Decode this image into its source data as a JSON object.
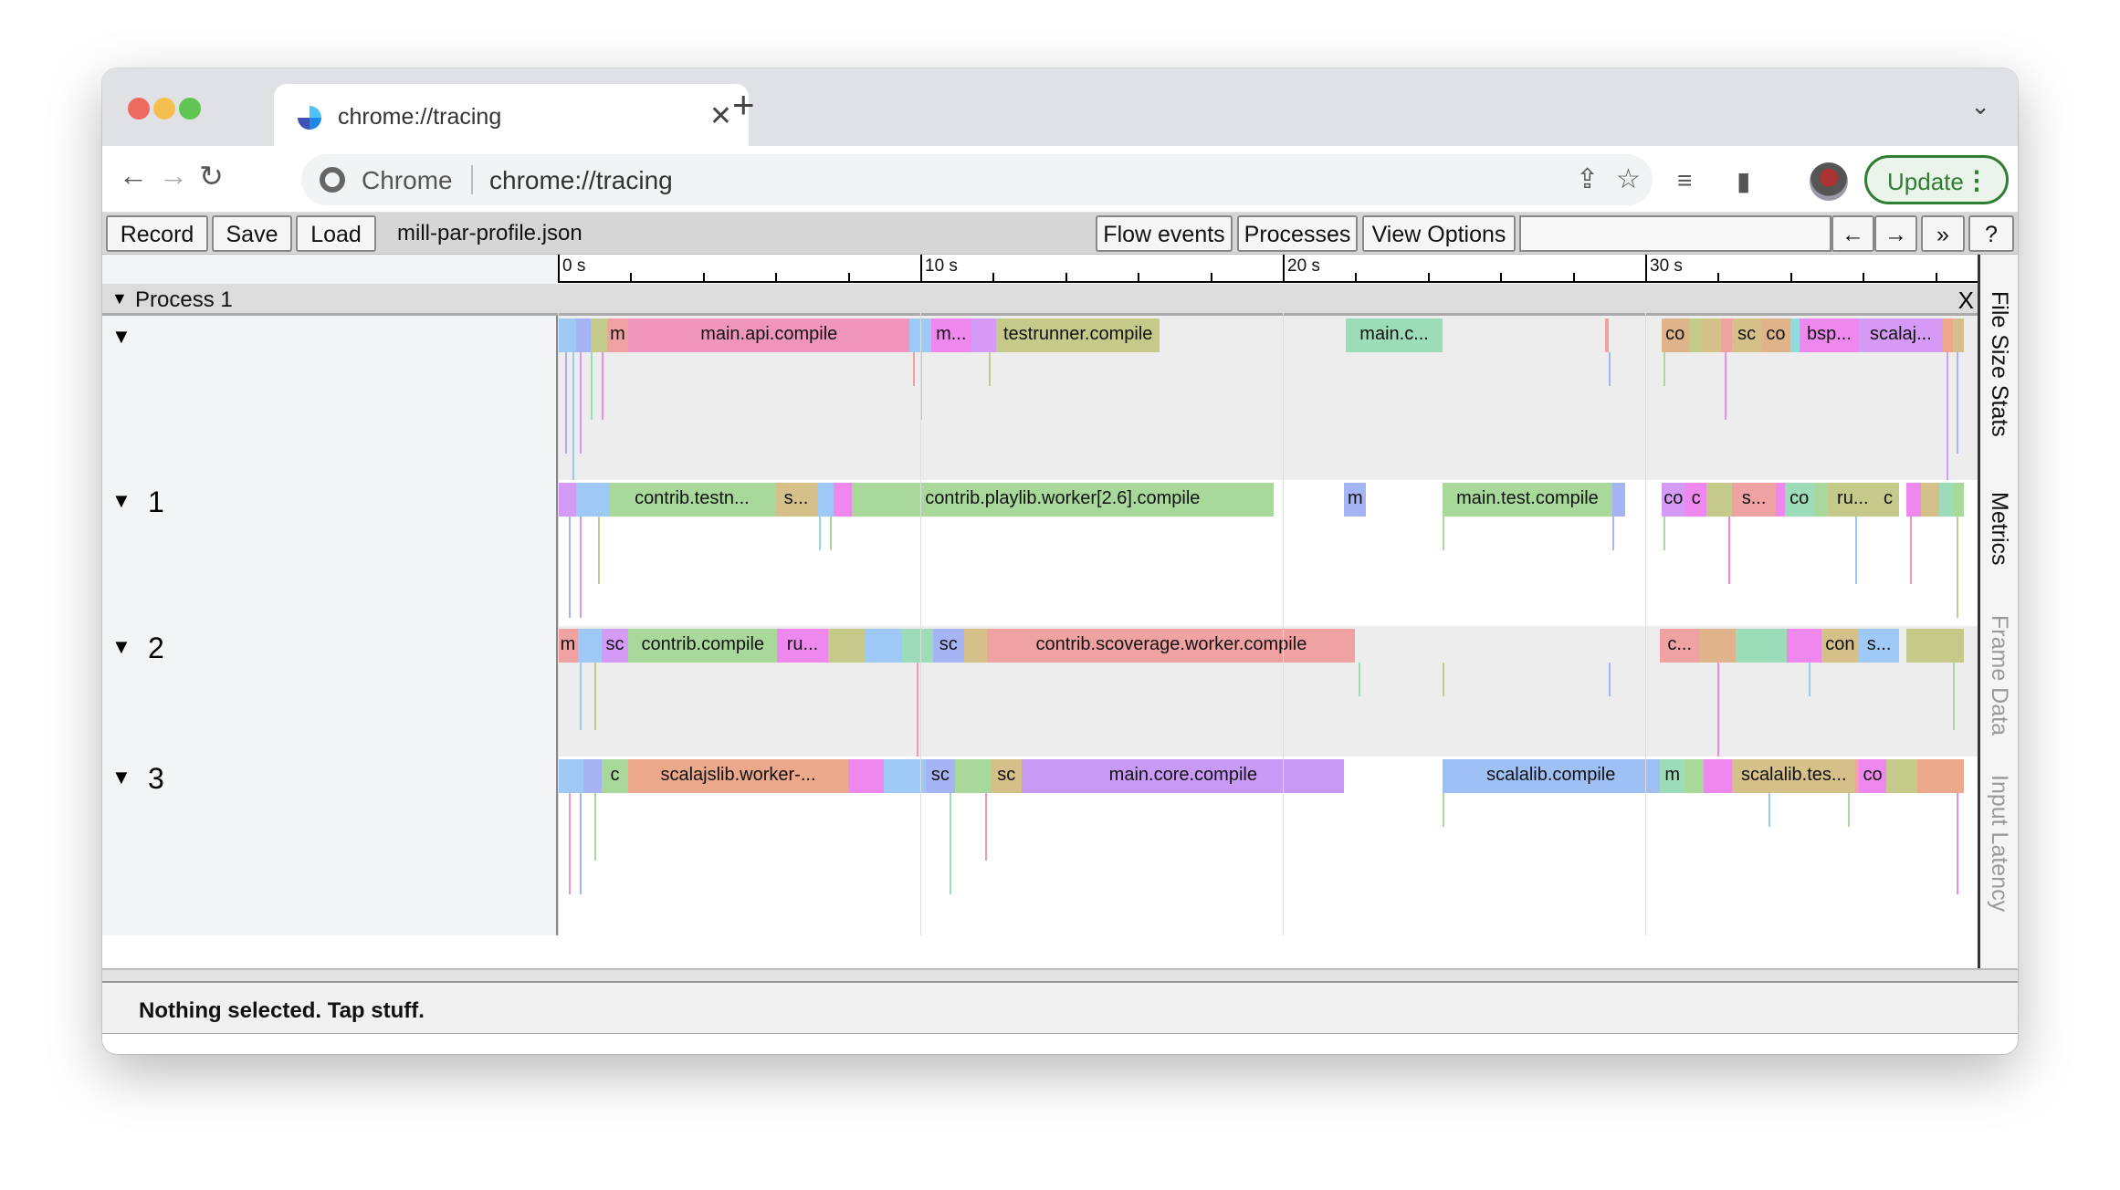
{
  "browser": {
    "tab_title": "chrome://tracing",
    "omnibox_label": "Chrome",
    "url": "chrome://tracing",
    "update_label": "Update",
    "traffic": {
      "close": "#ed6a5e",
      "min": "#f5bf4f",
      "max": "#61c554"
    }
  },
  "toolbar": {
    "record": "Record",
    "save": "Save",
    "load": "Load",
    "filename": "mill-par-profile.json",
    "flow_events": "Flow events",
    "processes": "Processes",
    "view_options": "View Options",
    "search_value": "",
    "prev": "←",
    "next": "→",
    "more": "»",
    "help": "?"
  },
  "ruler": {
    "labels": [
      {
        "t": 0,
        "text": "0 s"
      },
      {
        "t": 10,
        "text": "10 s"
      },
      {
        "t": 20,
        "text": "20 s"
      },
      {
        "t": 30,
        "text": "30 s"
      }
    ]
  },
  "process": {
    "label": "Process 1",
    "close": "X"
  },
  "side_tabs": [
    {
      "label": "File Size Stats",
      "enabled": true
    },
    {
      "label": "Metrics",
      "enabled": true
    },
    {
      "label": "Frame Data",
      "enabled": false
    },
    {
      "label": "Input Latency",
      "enabled": false
    }
  ],
  "status": "Nothing selected. Tap stuff.",
  "threads": [
    {
      "label": "",
      "slices": [
        {
          "s": 0,
          "e": 0.5,
          "c": "#9ec8f5"
        },
        {
          "s": 0.5,
          "e": 0.9,
          "c": "#a5b4f5"
        },
        {
          "s": 0.9,
          "e": 1.35,
          "c": "#c5c98a"
        },
        {
          "s": 1.35,
          "e": 1.95,
          "c": "#f0a1a1",
          "l": "m"
        },
        {
          "s": 1.95,
          "e": 9.7,
          "c": "#f096bd",
          "l": "main.api.compile"
        },
        {
          "s": 9.7,
          "e": 10.3,
          "c": "#9ec8f5"
        },
        {
          "s": 10.3,
          "e": 11.4,
          "c": "#ee88ee",
          "l": "m..."
        },
        {
          "s": 11.4,
          "e": 12.1,
          "c": "#d59af5"
        },
        {
          "s": 12.1,
          "e": 16.6,
          "c": "#c5c98a",
          "l": "testrunner.compile"
        },
        {
          "s": 21.75,
          "e": 24.4,
          "c": "#9cdcb8",
          "l": "main.c..."
        },
        {
          "s": 28.9,
          "e": 29.0,
          "c": "#f0a1a1"
        },
        {
          "s": 30.45,
          "e": 31.2,
          "c": "#dfb48a",
          "l": "co"
        },
        {
          "s": 31.2,
          "e": 31.6,
          "c": "#c5c98a"
        },
        {
          "s": 31.6,
          "e": 32.1,
          "c": "#d5c08a"
        },
        {
          "s": 32.1,
          "e": 32.4,
          "c": "#f0a1a1"
        },
        {
          "s": 32.4,
          "e": 33.2,
          "c": "#d5c08a",
          "l": "sc"
        },
        {
          "s": 33.2,
          "e": 34.0,
          "c": "#dfb48a",
          "l": "co"
        },
        {
          "s": 34.0,
          "e": 34.25,
          "c": "#8fdbe0"
        },
        {
          "s": 34.25,
          "e": 35.9,
          "c": "#ee88ee",
          "l": "bsp..."
        },
        {
          "s": 35.9,
          "e": 38.2,
          "c": "#d59af5",
          "l": "scalaj..."
        },
        {
          "s": 38.2,
          "e": 38.5,
          "c": "#eba88a"
        },
        {
          "s": 38.5,
          "e": 38.8,
          "c": "#d5c08a"
        }
      ],
      "deep": [
        [
          0.2,
          3,
          "#a5b4f5"
        ],
        [
          0.4,
          4,
          "#9ec8f5"
        ],
        [
          0.6,
          3,
          "#d59af5"
        ],
        [
          0.9,
          2,
          "#9cdcb8"
        ],
        [
          1.2,
          2,
          "#ee88ee"
        ],
        [
          9.8,
          1,
          "#f0a1a1"
        ],
        [
          10.0,
          2,
          "#9cdcb8"
        ],
        [
          11.9,
          1,
          "#c5c98a"
        ],
        [
          29.0,
          1,
          "#a5b4f5"
        ],
        [
          30.5,
          1,
          "#a9d99a"
        ],
        [
          32.2,
          2,
          "#ee88ee"
        ],
        [
          38.3,
          4,
          "#d59af5"
        ],
        [
          38.6,
          3,
          "#a5b4f5"
        ]
      ]
    },
    {
      "label": "1",
      "slices": [
        {
          "s": 0,
          "e": 0.5,
          "c": "#d59af5"
        },
        {
          "s": 0.5,
          "e": 1.4,
          "c": "#9ec8f5"
        },
        {
          "s": 1.4,
          "e": 6.0,
          "c": "#a9d99a",
          "l": "contrib.testn..."
        },
        {
          "s": 6.0,
          "e": 7.15,
          "c": "#d5c08a",
          "l": "s..."
        },
        {
          "s": 7.15,
          "e": 7.6,
          "c": "#9ec8f5"
        },
        {
          "s": 7.6,
          "e": 8.1,
          "c": "#ee88ee"
        },
        {
          "s": 8.1,
          "e": 19.75,
          "c": "#a9d99a",
          "l": "contrib.playlib.worker[2.6].compile"
        },
        {
          "s": 21.7,
          "e": 22.3,
          "c": "#a5b4f5",
          "l": "m"
        },
        {
          "s": 24.4,
          "e": 29.1,
          "c": "#a9d99a",
          "l": "main.test.compile"
        },
        {
          "s": 29.1,
          "e": 29.45,
          "c": "#a5b4f5"
        },
        {
          "s": 30.45,
          "e": 31.1,
          "c": "#d59af5",
          "l": "co"
        },
        {
          "s": 31.1,
          "e": 31.7,
          "c": "#ee88ee",
          "l": "c"
        },
        {
          "s": 31.7,
          "e": 32.4,
          "c": "#c5c98a"
        },
        {
          "s": 32.4,
          "e": 33.6,
          "c": "#f0a1a1",
          "l": "s..."
        },
        {
          "s": 33.6,
          "e": 33.85,
          "c": "#ee88ee"
        },
        {
          "s": 33.85,
          "e": 34.65,
          "c": "#9cdcb8",
          "l": "co"
        },
        {
          "s": 34.65,
          "e": 35.05,
          "c": "#a9d99a"
        },
        {
          "s": 35.05,
          "e": 36.4,
          "c": "#c5c98a",
          "l": "ru..."
        },
        {
          "s": 36.4,
          "e": 37.0,
          "c": "#c5c98a",
          "l": "c"
        },
        {
          "s": 37.2,
          "e": 37.6,
          "c": "#ee88ee"
        },
        {
          "s": 37.6,
          "e": 38.1,
          "c": "#d5c08a"
        },
        {
          "s": 38.1,
          "e": 38.5,
          "c": "#9cdcb8"
        },
        {
          "s": 38.5,
          "e": 38.8,
          "c": "#a9d99a"
        }
      ],
      "deep": [
        [
          0.3,
          3,
          "#a5b4f5"
        ],
        [
          0.6,
          3,
          "#d59af5"
        ],
        [
          1.1,
          2,
          "#c5c98a"
        ],
        [
          7.2,
          1,
          "#8fdbe0"
        ],
        [
          7.5,
          1,
          "#a9d99a"
        ],
        [
          24.4,
          1,
          "#a9d99a"
        ],
        [
          29.1,
          1,
          "#a5b4f5"
        ],
        [
          30.5,
          1,
          "#a9d99a"
        ],
        [
          32.3,
          2,
          "#ee88ee"
        ],
        [
          35.8,
          2,
          "#9ec8f5"
        ],
        [
          37.3,
          2,
          "#f096bd"
        ],
        [
          38.6,
          3,
          "#c5c98a"
        ]
      ]
    },
    {
      "label": "2",
      "slices": [
        {
          "s": 0,
          "e": 0.55,
          "c": "#f0a1a1",
          "l": "m"
        },
        {
          "s": 0.55,
          "e": 1.2,
          "c": "#9ec8f5"
        },
        {
          "s": 1.2,
          "e": 1.95,
          "c": "#d59af5",
          "l": "sc"
        },
        {
          "s": 1.95,
          "e": 6.05,
          "c": "#a9d99a",
          "l": "contrib.compile"
        },
        {
          "s": 6.05,
          "e": 7.45,
          "c": "#ee88ee",
          "l": "ru..."
        },
        {
          "s": 7.45,
          "e": 8.5,
          "c": "#c5c98a"
        },
        {
          "s": 8.5,
          "e": 9.5,
          "c": "#9ec8f5"
        },
        {
          "s": 9.5,
          "e": 10.35,
          "c": "#9cdcb8"
        },
        {
          "s": 10.35,
          "e": 11.2,
          "c": "#a5b4f5",
          "l": "sc"
        },
        {
          "s": 11.2,
          "e": 11.85,
          "c": "#d5c08a"
        },
        {
          "s": 11.85,
          "e": 22.0,
          "c": "#f0a1a1",
          "l": "contrib.scoverage.worker.compile"
        },
        {
          "s": 30.4,
          "e": 31.5,
          "c": "#f0a1a1",
          "l": "c..."
        },
        {
          "s": 31.5,
          "e": 32.5,
          "c": "#dfb48a"
        },
        {
          "s": 32.5,
          "e": 33.9,
          "c": "#9cdcb8"
        },
        {
          "s": 33.9,
          "e": 34.85,
          "c": "#ee88ee"
        },
        {
          "s": 34.85,
          "e": 35.9,
          "c": "#d5c08a",
          "l": "con"
        },
        {
          "s": 35.9,
          "e": 37.0,
          "c": "#9ec8f5",
          "l": "s..."
        },
        {
          "s": 37.2,
          "e": 38.8,
          "c": "#c5c98a"
        }
      ],
      "deep": [
        [
          0.6,
          2,
          "#9ec8f5"
        ],
        [
          1.0,
          2,
          "#c5c98a"
        ],
        [
          9.9,
          3,
          "#f096bd"
        ],
        [
          22.1,
          1,
          "#9cdcb8"
        ],
        [
          24.4,
          1,
          "#c5c98a"
        ],
        [
          29.0,
          1,
          "#a5b4f5"
        ],
        [
          32.0,
          3,
          "#ee88ee"
        ],
        [
          34.5,
          1,
          "#9ec8f5"
        ],
        [
          38.5,
          2,
          "#a9d99a"
        ]
      ]
    },
    {
      "label": "3",
      "slices": [
        {
          "s": 0,
          "e": 0.7,
          "c": "#9ec8f5"
        },
        {
          "s": 0.7,
          "e": 1.2,
          "c": "#a5b4f5"
        },
        {
          "s": 1.2,
          "e": 1.95,
          "c": "#a9d99a",
          "l": "c"
        },
        {
          "s": 1.95,
          "e": 8.0,
          "c": "#eba88a",
          "l": "scalajslib.worker-..."
        },
        {
          "s": 8.0,
          "e": 9.0,
          "c": "#ee88ee"
        },
        {
          "s": 9.0,
          "e": 10.15,
          "c": "#9ec8f5"
        },
        {
          "s": 10.15,
          "e": 10.95,
          "c": "#a5b4f5",
          "l": "sc"
        },
        {
          "s": 10.95,
          "e": 11.95,
          "c": "#a9d99a"
        },
        {
          "s": 11.95,
          "e": 12.8,
          "c": "#d5c08a",
          "l": "sc"
        },
        {
          "s": 12.8,
          "e": 21.7,
          "c": "#c99af5",
          "l": "main.core.compile"
        },
        {
          "s": 24.4,
          "e": 30.4,
          "c": "#9ec0f5",
          "l": "scalalib.compile"
        },
        {
          "s": 30.4,
          "e": 31.1,
          "c": "#9cdcb8",
          "l": "m"
        },
        {
          "s": 31.1,
          "e": 31.6,
          "c": "#a9d99a"
        },
        {
          "s": 31.6,
          "e": 32.4,
          "c": "#ee88ee"
        },
        {
          "s": 32.4,
          "e": 35.8,
          "c": "#d5c08a",
          "l": "scalalib.tes..."
        },
        {
          "s": 35.8,
          "e": 35.9,
          "c": "#f0a1a1"
        },
        {
          "s": 35.9,
          "e": 36.65,
          "c": "#ee88ee",
          "l": "co"
        },
        {
          "s": 36.65,
          "e": 37.5,
          "c": "#c5c98a"
        },
        {
          "s": 37.5,
          "e": 38.8,
          "c": "#eba88a"
        }
      ],
      "deep": [
        [
          0.3,
          3,
          "#f096bd"
        ],
        [
          0.6,
          3,
          "#a5b4f5"
        ],
        [
          1.0,
          2,
          "#a9d99a"
        ],
        [
          10.8,
          3,
          "#9cdcb8"
        ],
        [
          11.8,
          2,
          "#f096bd"
        ],
        [
          24.4,
          1,
          "#a9d99a"
        ],
        [
          33.4,
          1,
          "#9ec8f5"
        ],
        [
          35.6,
          1,
          "#a9d99a"
        ],
        [
          38.6,
          3,
          "#ee88ee"
        ]
      ]
    }
  ]
}
